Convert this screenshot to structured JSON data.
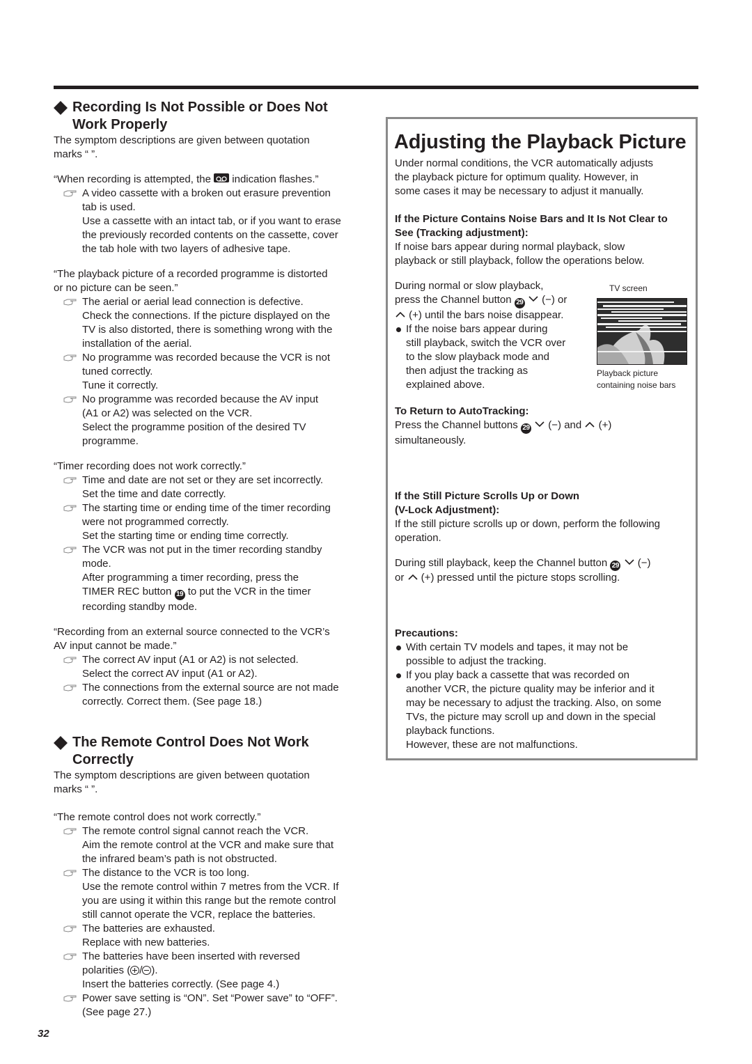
{
  "page_number": "32",
  "left": {
    "section1": {
      "title_line1": "Recording Is Not Possible or Does Not",
      "title_line2": "Work Properly",
      "intro_line1": "The symptom descriptions are given between quotation",
      "intro_line2": "marks “   ”.",
      "symptom1": {
        "text_before": "“When recording is attempted, the ",
        "icon": "cassette-indicator-icon",
        "text_after": " indication flashes.”",
        "causes": [
          {
            "cause_line1": "A video cassette with a broken out erasure prevention",
            "cause_line2": "tab is used.",
            "remedy_lines": [
              "Use a cassette with an intact tab, or if you want to erase",
              "the previously recorded contents on the cassette, cover",
              "the tab hole with two layers of adhesive tape."
            ]
          }
        ]
      },
      "symptom2": {
        "line1": "“The playback picture of a recorded programme is distorted",
        "line2": "or no picture can be seen.”",
        "causes": [
          {
            "cause_line1": "The aerial or aerial lead connection is defective.",
            "remedy_lines": [
              "Check the connections. If the picture displayed on the",
              "TV is also distorted, there is something wrong with the",
              "installation of the aerial."
            ]
          },
          {
            "cause_line1": "No programme was recorded because the VCR is not",
            "cause_line2": "tuned correctly.",
            "remedy_lines": [
              "Tune it correctly."
            ]
          },
          {
            "cause_line1": "No programme was recorded because the AV input",
            "cause_line2": "(A1 or A2) was selected on the VCR.",
            "remedy_lines": [
              "Select the programme position of the desired TV",
              "programme."
            ]
          }
        ]
      },
      "symptom3": {
        "line1": "“Timer recording does not work correctly.”",
        "causes": [
          {
            "cause_line1": "Time and date are not set or they are set incorrectly.",
            "remedy_lines": [
              "Set the time and date correctly."
            ]
          },
          {
            "cause_line1": "The starting time or ending time of the timer recording",
            "cause_line2": "were not programmed correctly.",
            "remedy_lines": [
              "Set the starting time or ending time correctly."
            ]
          },
          {
            "cause_line1": "The VCR was not put in the timer recording standby",
            "cause_line2": "mode.",
            "remedy_line1": "After programming a timer recording, press the",
            "remedy_line2_before": "TIMER REC button ",
            "remedy_line2_num": "19",
            "remedy_line2_after": " to put the VCR in the timer",
            "remedy_line3": "recording standby mode."
          }
        ]
      },
      "symptom4": {
        "line1": "“Recording from an external source connected to the VCR’s",
        "line2": "AV input cannot be made.”",
        "causes": [
          {
            "cause_line1": "The correct AV input (A1 or A2) is not selected.",
            "remedy_lines": [
              "Select the correct AV input (A1 or A2)."
            ]
          },
          {
            "cause_line1": "The connections from the external source are not made",
            "remedy_lines": [
              "correctly. Correct them. (See page 18.)"
            ]
          }
        ]
      }
    },
    "section2": {
      "title_line1": "The Remote Control Does Not Work",
      "title_line2": "Correctly",
      "intro_line1": "The symptom descriptions are given between quotation",
      "intro_line2": "marks “   ”.",
      "symptom1": {
        "line1": "“The remote control does not work correctly.”",
        "causes": [
          {
            "cause_line1": "The remote control signal cannot reach the VCR.",
            "remedy_lines": [
              "Aim the remote control at the VCR and make sure that",
              "the infrared beam’s path is not obstructed."
            ]
          },
          {
            "cause_line1": "The distance to the VCR is too long.",
            "remedy_lines": [
              "Use the remote control within 7 metres from the VCR. If",
              "you are using it within this range but the remote control",
              "still cannot operate the VCR, replace the batteries."
            ]
          },
          {
            "cause_line1": "The batteries are exhausted.",
            "remedy_lines": [
              "Replace with new batteries."
            ]
          },
          {
            "cause_line1": "The batteries have been inserted with reversed",
            "cause_line2_before": "polarities (",
            "cause_line2_sep": "/",
            "cause_line2_after": ").",
            "remedy_lines": [
              "Insert the batteries correctly. (See page 4.)"
            ]
          },
          {
            "cause_line1": "Power save setting is “ON”.  Set “Power save” to “OFF”.",
            "remedy_lines": [
              "(See page 27.)"
            ]
          }
        ]
      }
    }
  },
  "right": {
    "title": "Adjusting the Playback Picture",
    "intro_lines": [
      "Under normal conditions, the VCR automatically adjusts",
      "the playback picture for optimum quality. However, in",
      "some cases it may be necessary to adjust it manually."
    ],
    "tracking": {
      "heading_line1": "If the Picture Contains Noise Bars and It Is Not Clear to",
      "heading_line2": "See (Tracking adjustment):",
      "body_lines": [
        "If noise bars appear during normal playback, slow",
        "playback or still playback, follow the operations below."
      ],
      "step_line1": "During normal or slow playback,",
      "step_line2_before": "press the Channel button ",
      "button_num": "29",
      "step_line2_minus": " (−) or",
      "step_line3_plus": " (+) until the bars noise disappear.",
      "bullet_lines": [
        "If the noise bars appear during",
        "still playback, switch the VCR over",
        "to the slow playback mode and",
        "then adjust the tracking as",
        "explained above."
      ],
      "tv_label": "TV screen",
      "tv_caption_line1": "Playback picture",
      "tv_caption_line2": "containing noise bars"
    },
    "auto_tracking": {
      "heading": "To Return to AutoTracking:",
      "line1_before": "Press the Channel buttons ",
      "button_num": "29",
      "line1_minus": " (−) and ",
      "line1_plus": " (+)",
      "line2": "simultaneously."
    },
    "vlock": {
      "heading_line1": "If the Still Picture Scrolls Up or Down",
      "heading_line2": "(V-Lock Adjustment):",
      "body_lines": [
        "If the still picture scrolls up or down, perform the following",
        "operation."
      ],
      "step_line1_before": "During still playback, keep the Channel button ",
      "button_num": "29",
      "step_line1_minus": " (−)",
      "step_line2_or": "or ",
      "step_line2_plus": " (+) pressed until the picture stops scrolling."
    },
    "precautions": {
      "heading": "Precautions:",
      "bullet1_lines": [
        "With certain TV models and tapes, it may not be",
        "possible to adjust the tracking."
      ],
      "bullet2_lines": [
        "If you play back a cassette that was recorded on",
        "another VCR, the picture quality may be inferior and it",
        "may be necessary to adjust the tracking. Also, on some",
        "TVs, the picture may scroll up and down in the special",
        "playback functions.",
        "However, these are not malfunctions."
      ]
    }
  }
}
